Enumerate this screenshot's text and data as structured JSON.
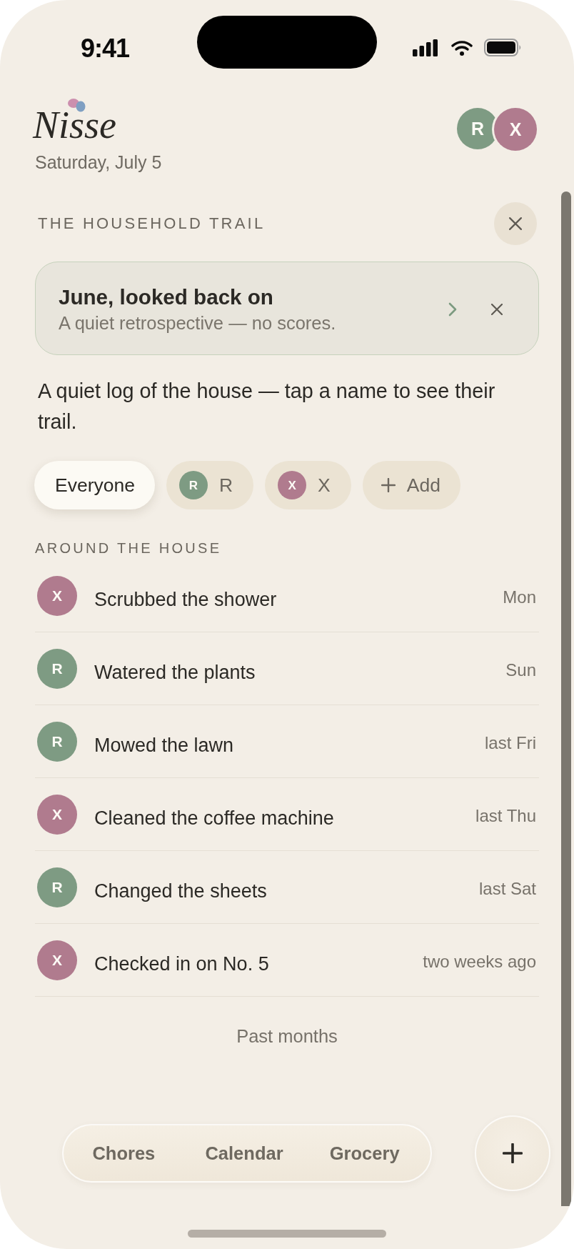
{
  "status_bar": {
    "time": "9:41"
  },
  "header": {
    "app_name": "Nisse",
    "date": "Saturday, July 5",
    "members": [
      {
        "initial": "R",
        "color": "#7e9b83"
      },
      {
        "initial": "X",
        "color": "#b07b8e"
      }
    ]
  },
  "trail": {
    "title": "THE HOUSEHOLD TRAIL",
    "banner": {
      "title": "June, looked back on",
      "subtitle": "A quiet retrospective — no scores."
    },
    "intro": "A quiet log of the house — tap a name to see their trail."
  },
  "filters": [
    {
      "kind": "all",
      "label": "Everyone",
      "selected": true
    },
    {
      "kind": "person",
      "initial": "R",
      "label": "R",
      "color": "#7e9b83",
      "selected": false
    },
    {
      "kind": "person",
      "initial": "X",
      "label": "X",
      "color": "#b07b8e",
      "selected": false
    },
    {
      "kind": "add",
      "label": "Add",
      "selected": false
    }
  ],
  "activity": {
    "title": "AROUND THE HOUSE",
    "items": [
      {
        "initial": "X",
        "color": "#b07b8e",
        "text": "Scrubbed the shower",
        "time": "Mon"
      },
      {
        "initial": "R",
        "color": "#7e9b83",
        "text": "Watered the plants",
        "time": "Sun"
      },
      {
        "initial": "R",
        "color": "#7e9b83",
        "text": "Mowed the lawn",
        "time": "last Fri"
      },
      {
        "initial": "X",
        "color": "#b07b8e",
        "text": "Cleaned the coffee machine",
        "time": "last Thu"
      },
      {
        "initial": "R",
        "color": "#7e9b83",
        "text": "Changed the sheets",
        "time": "last Sat"
      },
      {
        "initial": "X",
        "color": "#b07b8e",
        "text": "Checked in on No. 5",
        "time": "two weeks ago"
      }
    ],
    "more": "Past months"
  },
  "tab_bar": {
    "tabs": [
      {
        "label": "Chores",
        "selected": false
      },
      {
        "label": "Calendar",
        "selected": false
      },
      {
        "label": "Grocery",
        "selected": false
      }
    ]
  }
}
